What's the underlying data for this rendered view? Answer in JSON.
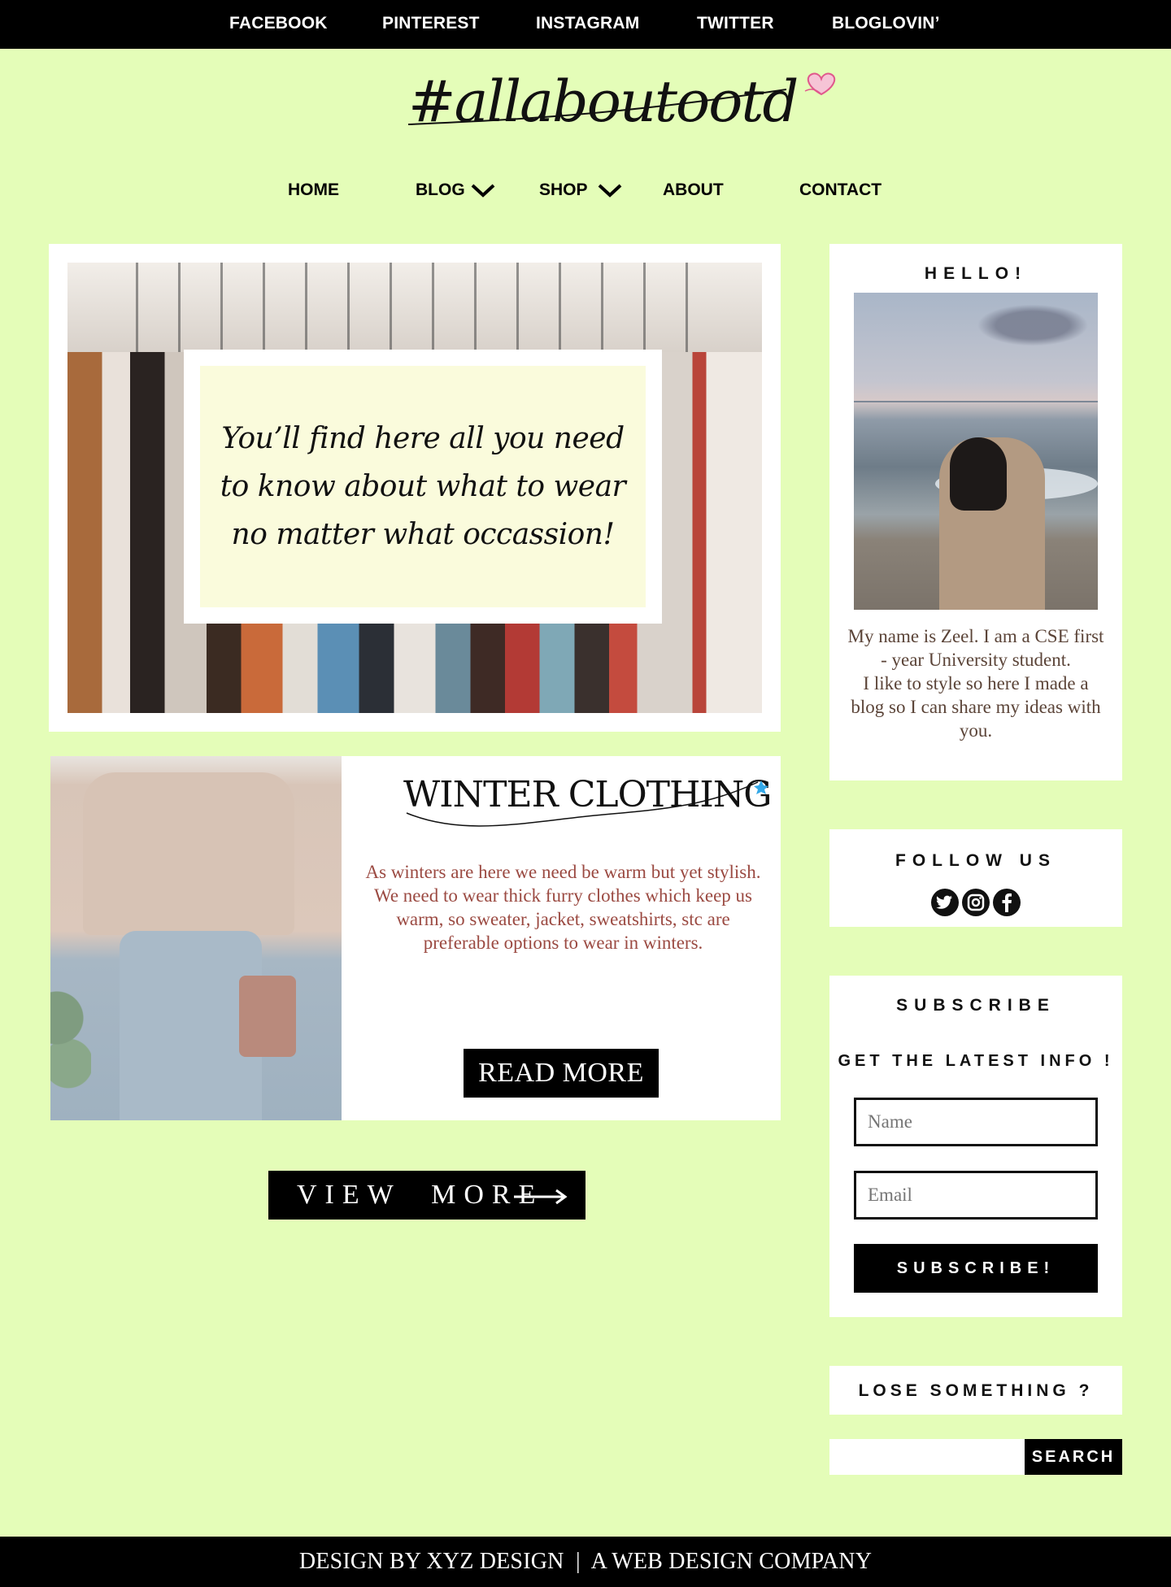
{
  "topbar": {
    "links": [
      "FACEBOOK",
      "PINTEREST",
      "INSTAGRAM",
      "TWITTER",
      "BLOGLOVIN’"
    ]
  },
  "logo": {
    "text": "#allaboutootd"
  },
  "nav": {
    "items": [
      {
        "label": "HOME",
        "has_dropdown": false
      },
      {
        "label": "BLOG",
        "has_dropdown": true
      },
      {
        "label": "SHOP",
        "has_dropdown": true
      },
      {
        "label": "ABOUT",
        "has_dropdown": false
      },
      {
        "label": "CONTACT",
        "has_dropdown": false
      }
    ]
  },
  "hero": {
    "quote": "You’ll find here all you need to know about what to wear no matter what occassion!"
  },
  "post": {
    "title": "WINTER CLOTHING",
    "text": "As winters are here we need be warm but yet stylish.\nWe need to wear thick furry clothes which keep us warm, so sweater, jacket, sweatshirts, stc are preferable options to wear in winters.",
    "read_more_label": "READ MORE"
  },
  "view_more_label": "VIEW  MORE",
  "sidebar": {
    "hello": {
      "title": "HELLO!",
      "text": "My name is Zeel. I am a CSE first - year University student.\nI like to style so here I made a blog so I can share my ideas with you."
    },
    "follow": {
      "title": "FOLLOW US",
      "icons": [
        "twitter-icon",
        "instagram-icon",
        "facebook-icon"
      ]
    },
    "subscribe": {
      "title": "SUBSCRIBE",
      "subtitle": "GET THE LATEST INFO !",
      "name_placeholder": "Name",
      "email_placeholder": "Email",
      "button_label": "SUBSCRIBE!"
    },
    "search": {
      "title": "LOSE SOMETHING ?",
      "button_label": "SEARCH"
    }
  },
  "footer": {
    "text": "DESIGN BY XYZ DESIGN  |  A WEB DESIGN COMPANY"
  },
  "colors": {
    "background": "#e4fdb8",
    "post_text": "#9b4a42",
    "hero_card": "#fafbdc",
    "heart": "#f08bb0",
    "star": "#33a8e8"
  }
}
